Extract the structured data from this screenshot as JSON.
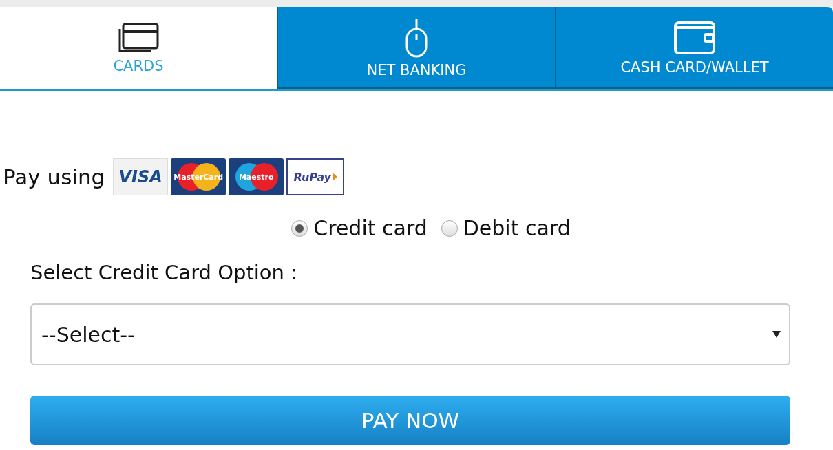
{
  "tabs": [
    {
      "label": "CARDS",
      "kind": "cards",
      "selected": true
    },
    {
      "label": "NET BANKING",
      "kind": "mouse",
      "selected": false
    },
    {
      "label": "CASH CARD/WALLET",
      "kind": "wallet",
      "selected": false
    }
  ],
  "pay_using": {
    "label": "Pay using",
    "logos": [
      {
        "kind": "visa",
        "label": "VISA"
      },
      {
        "kind": "mastercard",
        "label": "MasterCard"
      },
      {
        "kind": "maestro",
        "label": "Maestro"
      },
      {
        "kind": "rupay",
        "label": "RuPay"
      }
    ]
  },
  "card_types": [
    {
      "label": "Credit card",
      "selected": true
    },
    {
      "label": "Debit card",
      "selected": false
    }
  ],
  "option_label": "Select Credit Card Option :",
  "select": {
    "value": "--Select--"
  },
  "pay_button": "PAY NOW"
}
